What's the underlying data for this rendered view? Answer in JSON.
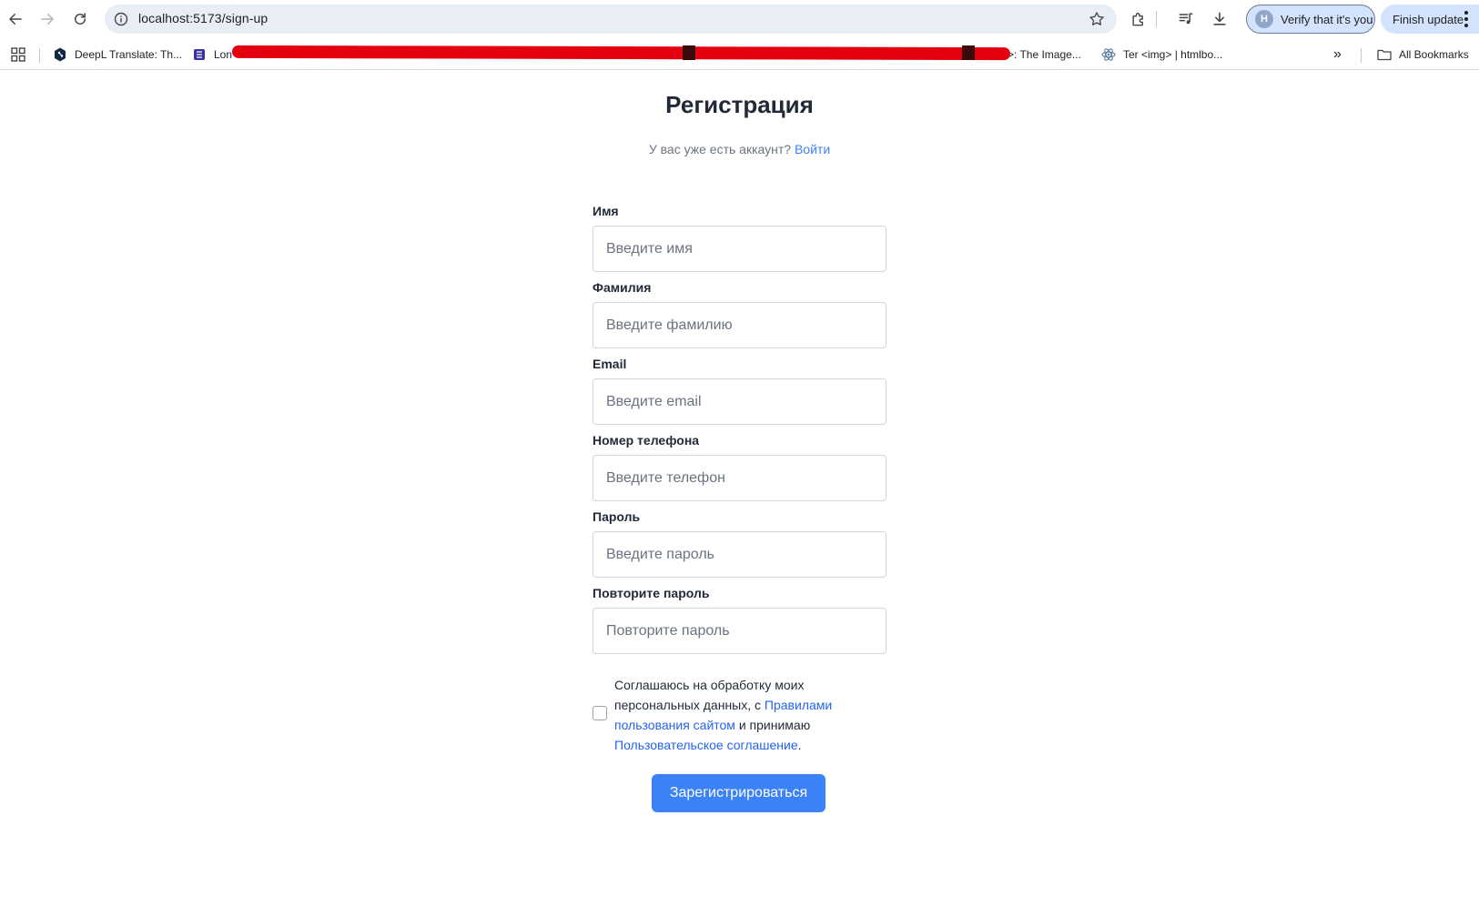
{
  "browser": {
    "url": "localhost:5173/sign-up",
    "verify_label": "Verify that it's you",
    "verify_avatar": "H",
    "update_label": "Finish update",
    "bookmarks": [
      {
        "label": "DeepL Translate: Th...",
        "icon": "deepl-icon"
      },
      {
        "label": "Lon",
        "icon": "bookmark-site-icon"
      },
      {
        "label": ">: The Image...",
        "icon": ""
      },
      {
        "label": "Ter <img> | htmlbo...",
        "icon": "react-icon"
      }
    ],
    "more_bookmarks": "»",
    "all_bookmarks_label": "All Bookmarks"
  },
  "page": {
    "title": "Регистрация",
    "subtitle_text": "У вас уже есть аккаунт?",
    "login_link": "Войти"
  },
  "form": {
    "fields": [
      {
        "label": "Имя",
        "placeholder": "Введите имя",
        "value": ""
      },
      {
        "label": "Фамилия",
        "placeholder": "Введите фамилию",
        "value": ""
      },
      {
        "label": "Email",
        "placeholder": "Введите email",
        "value": ""
      },
      {
        "label": "Номер телефона",
        "placeholder": "Введите телефон",
        "value": ""
      },
      {
        "label": "Пароль",
        "placeholder": "Введите пароль",
        "value": ""
      },
      {
        "label": "Повторите пароль",
        "placeholder": "Повторите пароль",
        "value": ""
      }
    ],
    "consent": {
      "checked": false,
      "text_1": "Соглашаюсь на обработку моих персональных данных, с ",
      "link_rules": "Правилами пользования сайтом",
      "text_2": " и принимаю ",
      "link_agreement": "Пользовательское соглашение",
      "text_3": "."
    },
    "submit_label": "Зарегистрироваться"
  },
  "colors": {
    "accent": "#3b82f6",
    "link": "#2563eb",
    "redaction": "#e3000f"
  }
}
